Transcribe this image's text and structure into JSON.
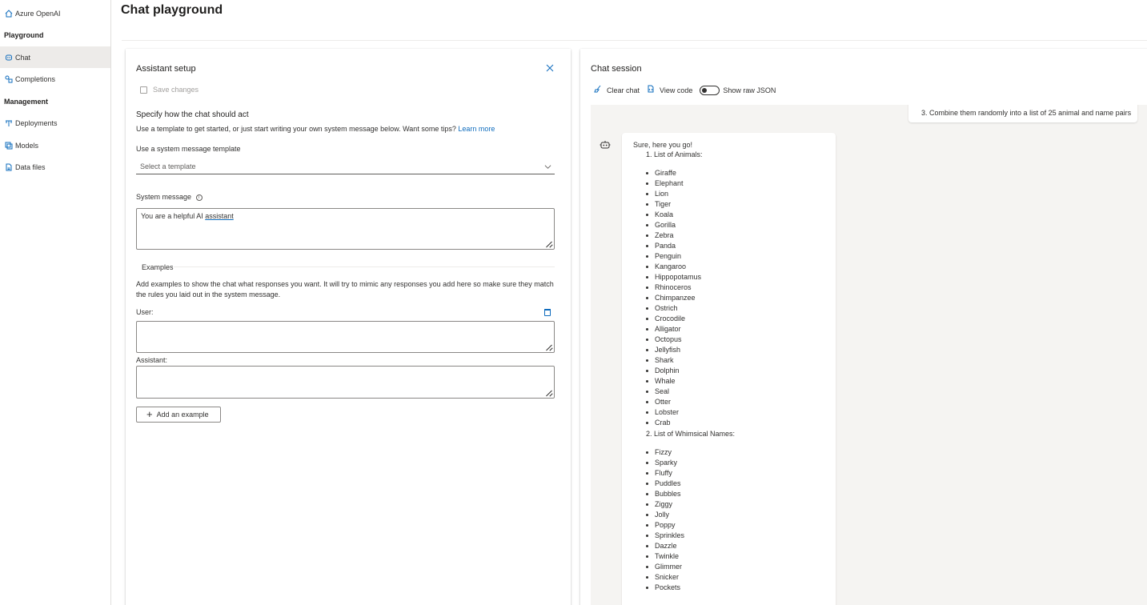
{
  "sidebar": {
    "home": "Azure OpenAI",
    "playground_heading": "Playground",
    "chat": "Chat",
    "completions": "Completions",
    "management_heading": "Management",
    "deployments": "Deployments",
    "models": "Models",
    "data_files": "Data files"
  },
  "header": {
    "title": "Chat playground"
  },
  "setup": {
    "title": "Assistant setup",
    "save_changes": "Save changes",
    "specify_heading": "Specify how the chat should act",
    "specify_text": "Use a template to get started, or just start writing your own system message below. Want some tips?",
    "learn_more": "Learn more",
    "template_label": "Use a system message template",
    "template_placeholder": "Select a template",
    "system_message_label": "System message",
    "system_message_prefix": "You are a helpful AI ",
    "system_message_underlined": "assistant",
    "examples_heading": "Examples",
    "examples_text": "Add examples to show the chat what responses you want. It will try to mimic any responses you add here so make sure they match the rules you laid out in the system message.",
    "user_label": "User:",
    "assistant_label": "Assistant:",
    "add_example": "Add an example"
  },
  "session": {
    "title": "Chat session",
    "clear_chat": "Clear chat",
    "view_code": "View code",
    "show_raw_json": "Show raw JSON",
    "show_raw_json_on": false,
    "user_message_tail": "3. Combine them randomly into a list of 25 animal and name pairs",
    "bot_intro": "Sure, here you go!",
    "list1_heading": "1. List of Animals:",
    "animals": [
      "Giraffe",
      "Elephant",
      "Lion",
      "Tiger",
      "Koala",
      "Gorilla",
      "Zebra",
      "Panda",
      "Penguin",
      "Kangaroo",
      "Hippopotamus",
      "Rhinoceros",
      "Chimpanzee",
      "Ostrich",
      "Crocodile",
      "Alligator",
      "Octopus",
      "Jellyfish",
      "Shark",
      "Dolphin",
      "Whale",
      "Seal",
      "Otter",
      "Lobster",
      "Crab"
    ],
    "list2_heading": "2. List of Whimsical Names:",
    "names": [
      "Fizzy",
      "Sparky",
      "Fluffy",
      "Puddles",
      "Bubbles",
      "Ziggy",
      "Jolly",
      "Poppy",
      "Sprinkles",
      "Dazzle",
      "Twinkle",
      "Glimmer",
      "Snicker",
      "Pockets"
    ]
  },
  "colors": {
    "accent": "#0f6cbd",
    "nav_active_bg": "#edebe9",
    "chat_bg": "#f5f4f2"
  },
  "icons": {
    "home": "home-icon",
    "chat": "chat-icon",
    "completions": "completions-icon",
    "deployments": "deployments-icon",
    "models": "models-icon",
    "data_files": "data-files-icon",
    "close": "close-icon",
    "save": "save-icon",
    "info": "info-icon",
    "chevron": "chevron-down-icon",
    "trash": "trash-icon",
    "plus": "plus-icon",
    "broom": "broom-icon",
    "code": "code-icon",
    "bot": "bot-icon"
  }
}
